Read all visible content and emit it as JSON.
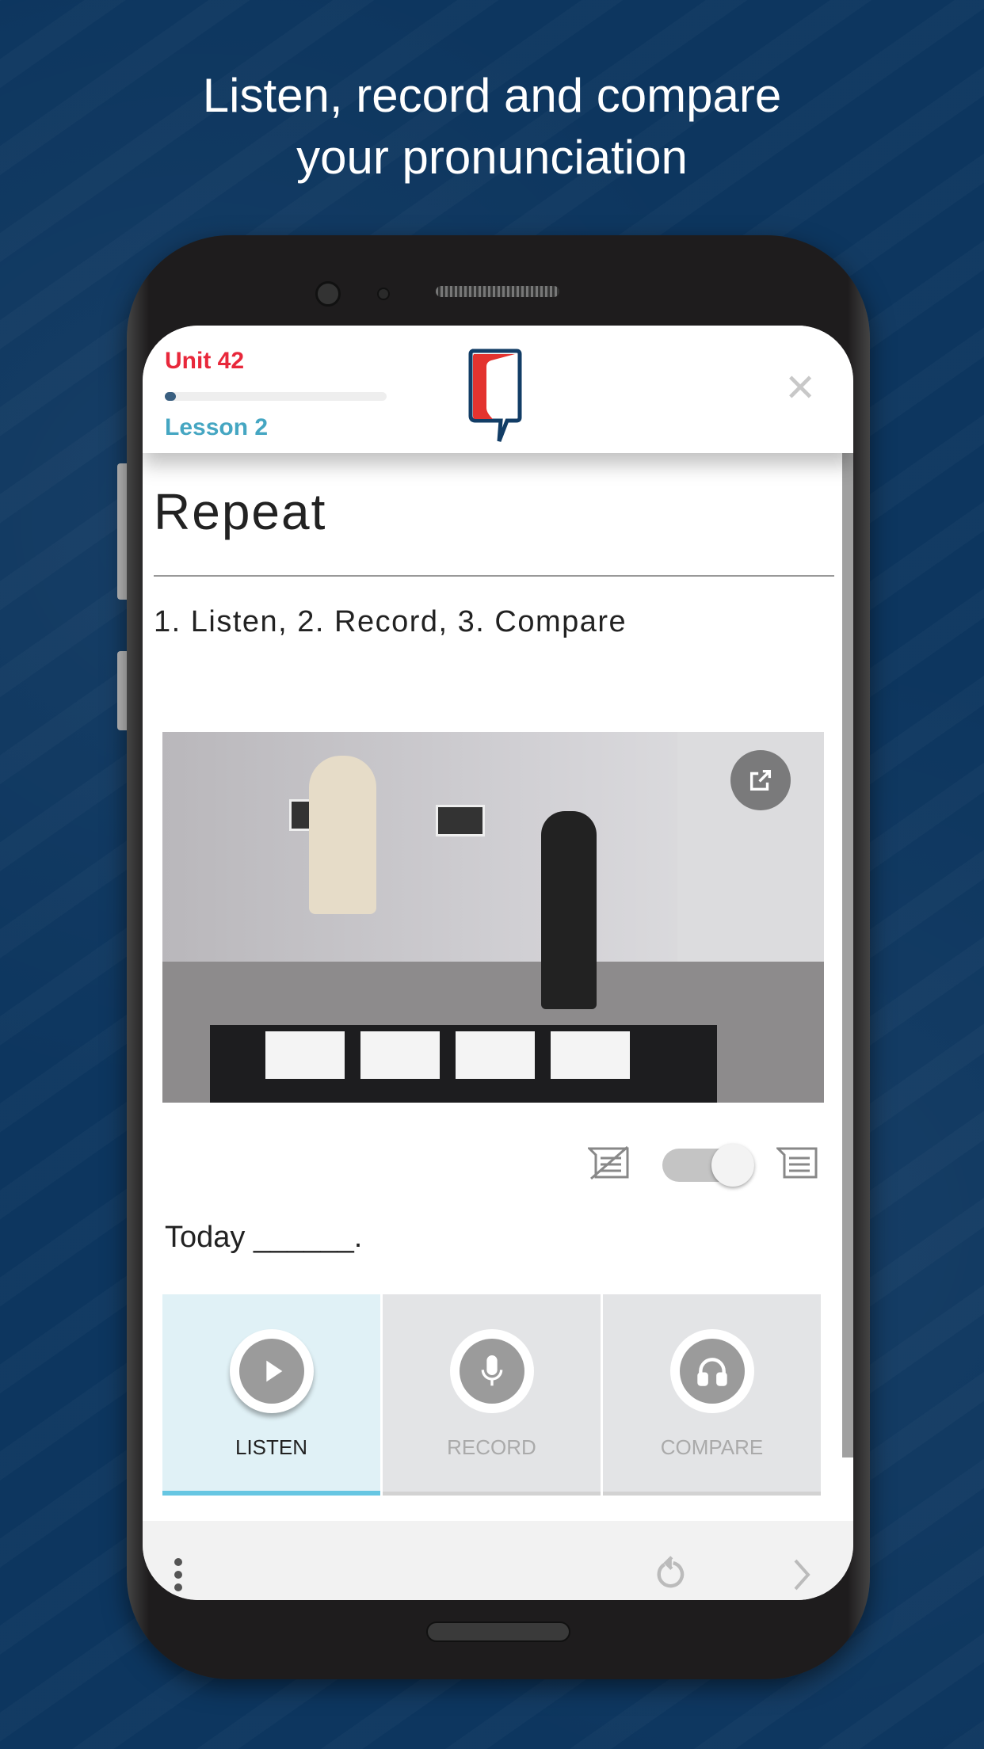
{
  "headline": {
    "line1": "Listen, record and compare",
    "line2": "your pronunciation"
  },
  "header": {
    "unit": "Unit 42",
    "lesson": "Lesson 2",
    "progress_percent": 3,
    "logo": "Wall Street English speech-bubble logo",
    "close_icon": "close-icon"
  },
  "exercise": {
    "title": "Repeat",
    "instructions": "1. Listen, 2. Record, 3. Compare",
    "sentence": "Today ______."
  },
  "video": {
    "expand_icon": "external-link-icon"
  },
  "transcript_toggle": {
    "on": true,
    "off_icon": "transcript-off-icon",
    "on_icon": "transcript-icon"
  },
  "actions": [
    {
      "label": "LISTEN",
      "icon": "play-icon",
      "active": true
    },
    {
      "label": "RECORD",
      "icon": "microphone-icon",
      "active": false
    },
    {
      "label": "COMPARE",
      "icon": "headphones-icon",
      "active": false
    }
  ],
  "bottom_bar": {
    "menu_icon": "more-vertical-icon",
    "replay_icon": "replay-icon",
    "next_icon": "chevron-right-icon"
  },
  "colors": {
    "background": "#0d365f",
    "unit": "#e8283b",
    "lesson": "#45a6c2",
    "active_tab": "#66c6e2"
  }
}
